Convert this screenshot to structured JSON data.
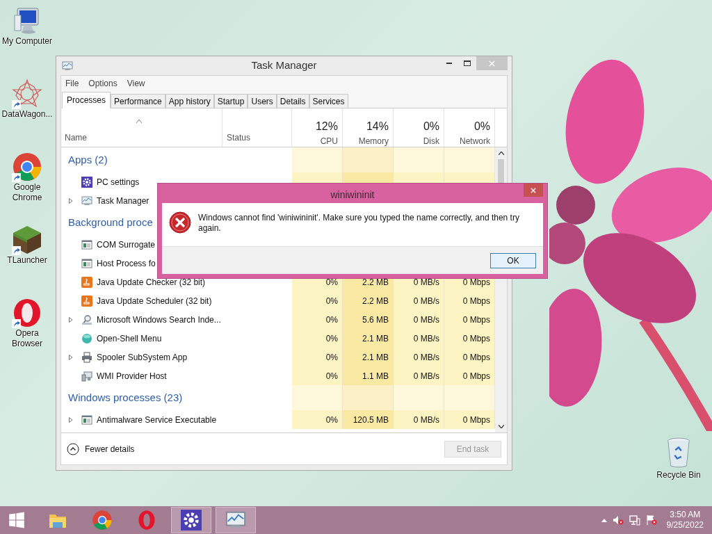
{
  "desktop_icons": [
    {
      "label": "My Computer",
      "kind": "computer",
      "shortcut": false
    },
    {
      "label": "DataWagon...",
      "kind": "star",
      "shortcut": true
    },
    {
      "label": "Google Chrome",
      "kind": "chrome",
      "shortcut": true
    },
    {
      "label": "TLauncher",
      "kind": "cube",
      "shortcut": true
    },
    {
      "label": "Opera Browser",
      "kind": "opera",
      "shortcut": true
    }
  ],
  "recycle_bin": {
    "label": "Recycle Bin"
  },
  "task_manager": {
    "title": "Task Manager",
    "menu": [
      "File",
      "Options",
      "View"
    ],
    "tabs": [
      {
        "label": "Processes",
        "selected": true
      },
      {
        "label": "Performance",
        "selected": false
      },
      {
        "label": "App history",
        "selected": false
      },
      {
        "label": "Startup",
        "selected": false
      },
      {
        "label": "Users",
        "selected": false
      },
      {
        "label": "Details",
        "selected": false
      },
      {
        "label": "Services",
        "selected": false
      }
    ],
    "columns": [
      {
        "label": "Name",
        "sorted": true
      },
      {
        "label": "Status"
      },
      {
        "label": "CPU",
        "total": "12%"
      },
      {
        "label": "Memory",
        "total": "14%"
      },
      {
        "label": "Disk",
        "total": "0%"
      },
      {
        "label": "Network",
        "total": "0%"
      }
    ],
    "groups": [
      {
        "title": "Apps (2)",
        "rows": [
          {
            "name": "PC settings",
            "kind": "settings",
            "expandable": false
          },
          {
            "name": "Task Manager",
            "kind": "taskmgr",
            "expandable": true
          }
        ]
      },
      {
        "title": "Background proce",
        "rows": [
          {
            "name": "COM Surrogate",
            "kind": "window",
            "expandable": false
          },
          {
            "name": "Host Process fo",
            "kind": "window",
            "expandable": false
          },
          {
            "name": "Java Update Checker (32 bit)",
            "kind": "java",
            "expandable": false,
            "values": [
              "0%",
              "2.2 MB",
              "0 MB/s",
              "0 Mbps"
            ]
          },
          {
            "name": "Java Update Scheduler (32 bit)",
            "kind": "java",
            "expandable": false,
            "values": [
              "0%",
              "2.2 MB",
              "0 MB/s",
              "0 Mbps"
            ]
          },
          {
            "name": "Microsoft Windows Search Inde...",
            "kind": "search",
            "expandable": true,
            "values": [
              "0%",
              "5.6 MB",
              "0 MB/s",
              "0 Mbps"
            ]
          },
          {
            "name": "Open-Shell Menu",
            "kind": "shell",
            "expandable": false,
            "values": [
              "0%",
              "2.1 MB",
              "0 MB/s",
              "0 Mbps"
            ]
          },
          {
            "name": "Spooler SubSystem App",
            "kind": "printer",
            "expandable": true,
            "values": [
              "0%",
              "2.1 MB",
              "0 MB/s",
              "0 Mbps"
            ]
          },
          {
            "name": "WMI Provider Host",
            "kind": "wmi",
            "expandable": false,
            "values": [
              "0%",
              "1.1 MB",
              "0 MB/s",
              "0 Mbps"
            ]
          }
        ]
      },
      {
        "title": "Windows processes (23)",
        "rows": [
          {
            "name": "Antimalware Service Executable",
            "kind": "window",
            "expandable": true,
            "values": [
              "0%",
              "120.5 MB",
              "0 MB/s",
              "0 Mbps"
            ]
          }
        ]
      }
    ],
    "fewer_details": "Fewer details",
    "end_task": {
      "label": "End task",
      "disabled": true
    }
  },
  "dialog": {
    "title": "winiwininit",
    "message": "Windows cannot find 'winiwininit'. Make sure you typed the name correctly, and then try again.",
    "button": "OK"
  },
  "taskbar": {
    "items": [
      {
        "kind": "explorer",
        "active": false
      },
      {
        "kind": "chrome",
        "active": false
      },
      {
        "kind": "opera",
        "active": false
      },
      {
        "kind": "settings",
        "active": true
      },
      {
        "kind": "taskmgr",
        "active": true
      }
    ],
    "time": "3:50 AM",
    "date": "9/25/2022"
  }
}
